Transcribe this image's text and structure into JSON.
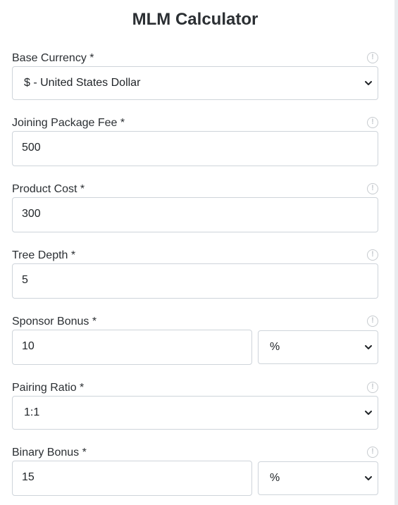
{
  "title": "MLM Calculator",
  "info_icon": "info-circle-icon",
  "fields": {
    "base_currency": {
      "label": "Base Currency *",
      "value": "$ - United States Dollar"
    },
    "joining_fee": {
      "label": "Joining Package Fee *",
      "value": "500"
    },
    "product_cost": {
      "label": "Product Cost *",
      "value": "300"
    },
    "tree_depth": {
      "label": "Tree Depth *",
      "value": "5"
    },
    "sponsor_bonus": {
      "label": "Sponsor Bonus *",
      "value": "10",
      "unit": "%"
    },
    "pairing_ratio": {
      "label": "Pairing Ratio *",
      "value": "1:1"
    },
    "binary_bonus": {
      "label": "Binary Bonus *",
      "value": "15",
      "unit": "%"
    }
  },
  "info_glyph": "!"
}
